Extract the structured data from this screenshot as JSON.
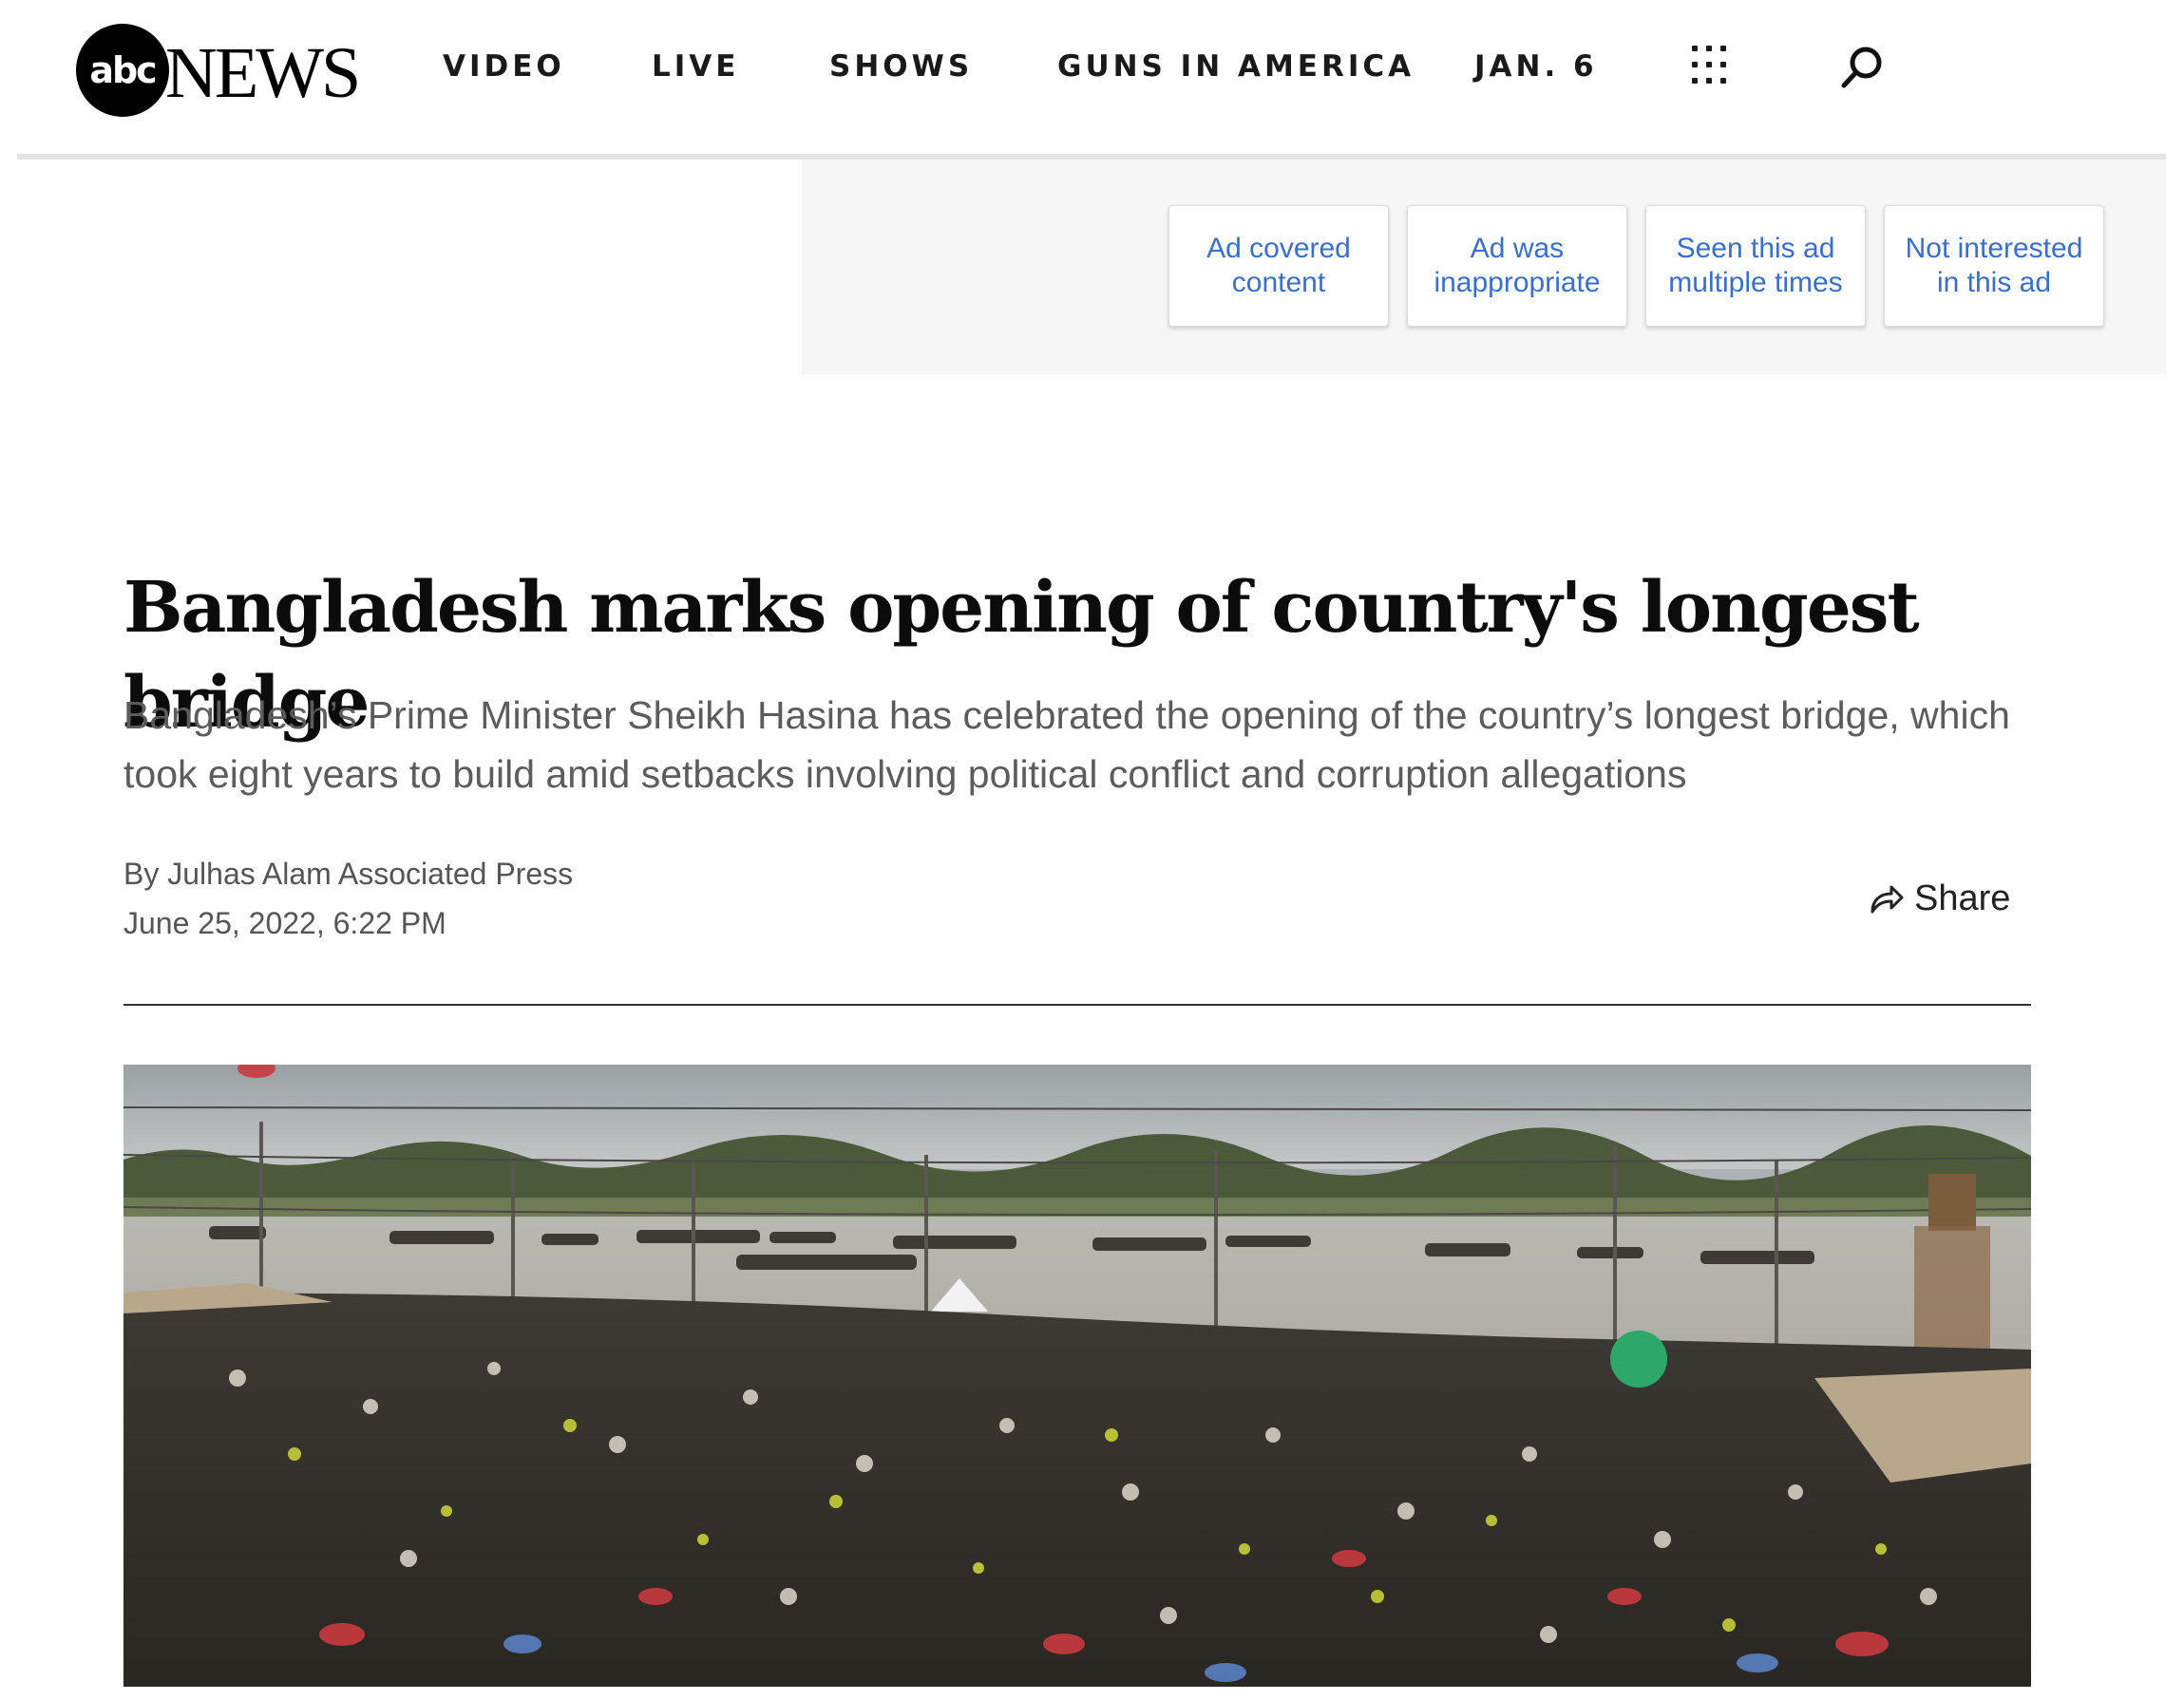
{
  "header": {
    "logo_abc": "abc",
    "logo_news": "NEWS",
    "nav": [
      "VIDEO",
      "LIVE",
      "SHOWS",
      "GUNS IN AMERICA",
      "JAN. 6"
    ],
    "icons": {
      "more": "grid-dots-icon",
      "search": "search-icon"
    }
  },
  "ad_feedback": {
    "buttons": [
      "Ad covered content",
      "Ad was inappropriate",
      "Seen this ad multiple times",
      "Not interested in this ad"
    ]
  },
  "article": {
    "headline": "Bangladesh marks opening of country's longest bridge",
    "dek": "Bangladesh’s Prime Minister Sheikh Hasina has celebrated the opening of the country’s longest bridge, which took eight years to build amid setbacks involving political conflict and corruption allegations",
    "byline": "By Julhas Alam Associated Press",
    "date": "June 25, 2022, 6:22 PM",
    "share_label": "Share"
  },
  "colors": {
    "link_blue": "#3a6fc9",
    "ad_bg": "#f6f6f6",
    "text_gray": "#5c5c5c"
  }
}
